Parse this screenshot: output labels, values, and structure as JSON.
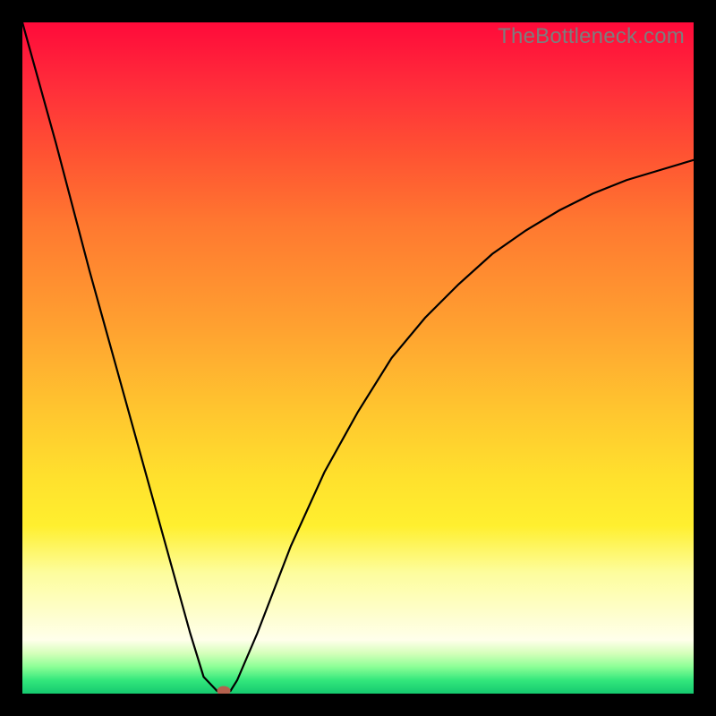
{
  "watermark": "TheBottleneck.com",
  "chart_data": {
    "type": "line",
    "title": "",
    "xlabel": "",
    "ylabel": "",
    "xlim": [
      0,
      100
    ],
    "ylim": [
      0,
      100
    ],
    "series": [
      {
        "name": "curve",
        "x": [
          0,
          5,
          10,
          15,
          20,
          25,
          27,
          29,
          30,
          31,
          32,
          35,
          40,
          45,
          50,
          55,
          60,
          65,
          70,
          75,
          80,
          85,
          90,
          95,
          100
        ],
        "y": [
          100,
          82,
          63,
          45,
          27,
          9,
          2.5,
          0.4,
          0.4,
          0.4,
          2,
          9,
          22,
          33,
          42,
          50,
          56,
          61,
          65.5,
          69,
          72,
          74.5,
          76.5,
          78,
          79.5
        ]
      }
    ],
    "marker": {
      "x": 30,
      "y": 0.4
    },
    "background_gradient": {
      "top": "#ff0a3a",
      "mid": "#ffc62f",
      "bottom": "#15c96f"
    }
  }
}
